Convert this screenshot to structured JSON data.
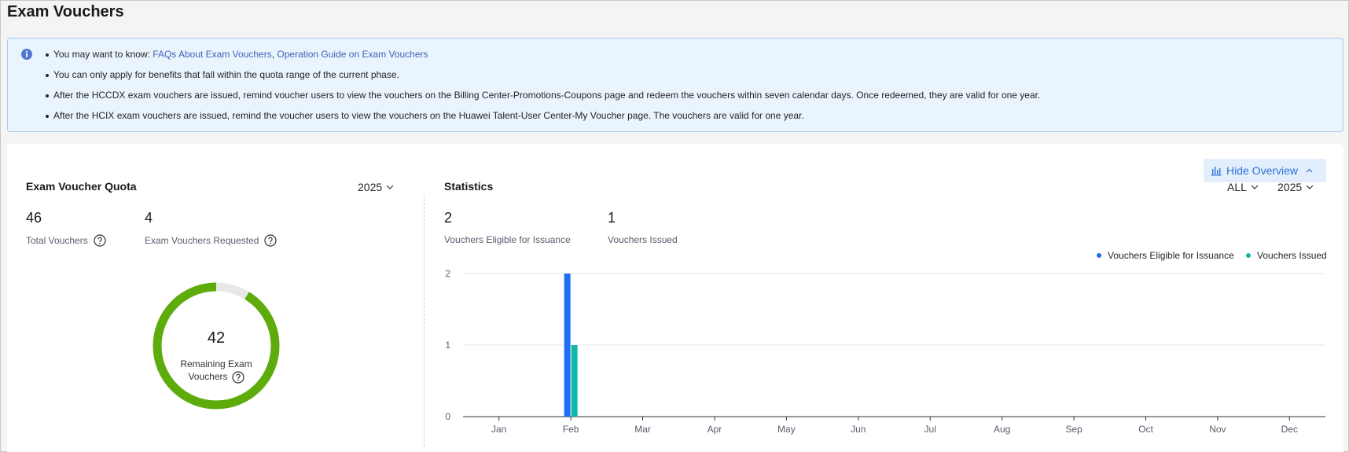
{
  "page": {
    "title": "Exam Vouchers"
  },
  "notice": {
    "intro": "You may want to know: ",
    "link1": "FAQs About Exam Vouchers",
    "sep": ", ",
    "link2": "Operation Guide on Exam Vouchers",
    "lines": [
      "You can only apply for benefits that fall within the quota range of the current phase.",
      "After the HCCDX exam vouchers are issued, remind voucher users to view the vouchers on the Billing Center-Promotions-Coupons page and redeem the vouchers within seven calendar days. Once redeemed, they are valid for one year.",
      "After the HCIX exam vouchers are issued, remind the voucher users to view the vouchers on the Huawei Talent-User Center-My Voucher page. The vouchers are valid for one year."
    ]
  },
  "toolbar": {
    "hide_overview": "Hide Overview"
  },
  "quota": {
    "title": "Exam Voucher Quota",
    "year": "2025",
    "total_value": "46",
    "total_label": "Total Vouchers",
    "requested_value": "4",
    "requested_label": "Exam Vouchers Requested",
    "remaining_value": "42",
    "remaining_label_line1": "Remaining Exam",
    "remaining_label_line2": "Vouchers",
    "remaining_fraction": 0.913
  },
  "statistics": {
    "title": "Statistics",
    "filter": "ALL",
    "year": "2025",
    "eligible_value": "2",
    "eligible_label": "Vouchers Eligible for Issuance",
    "issued_value": "1",
    "issued_label": "Vouchers Issued"
  },
  "colors": {
    "eligible": "#1f6ff2",
    "issued": "#14b6aa",
    "donut_fill": "#5dac0b",
    "donut_track": "#e8e8e8"
  },
  "chart_data": {
    "type": "bar",
    "categories": [
      "Jan",
      "Feb",
      "Mar",
      "Apr",
      "May",
      "Jun",
      "Jul",
      "Aug",
      "Sep",
      "Oct",
      "Nov",
      "Dec"
    ],
    "series": [
      {
        "name": "Vouchers Eligible for Issuance",
        "values": [
          0,
          2,
          0,
          0,
          0,
          0,
          0,
          0,
          0,
          0,
          0,
          0
        ]
      },
      {
        "name": "Vouchers Issued",
        "values": [
          0,
          1,
          0,
          0,
          0,
          0,
          0,
          0,
          0,
          0,
          0,
          0
        ]
      }
    ],
    "yticks": [
      0,
      1,
      2
    ],
    "ylim": [
      0,
      2
    ],
    "legend": "top-right",
    "grid": true
  }
}
